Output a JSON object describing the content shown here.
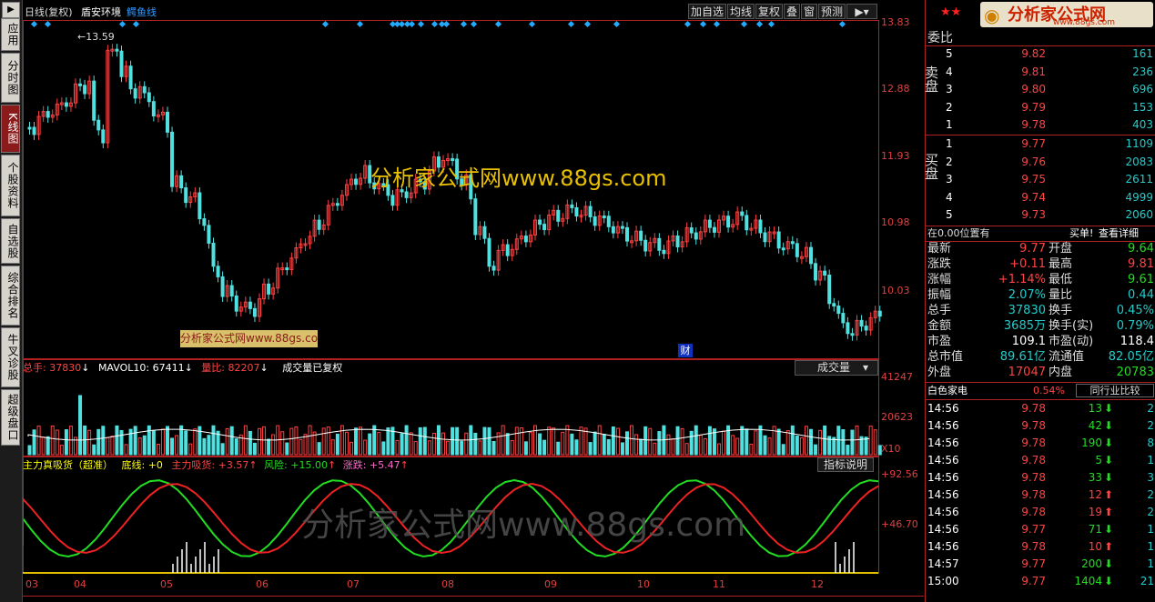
{
  "side_tabs": [
    {
      "label": "应用",
      "active": false
    },
    {
      "label": "分时图",
      "active": false
    },
    {
      "label": "K线图",
      "active": true
    },
    {
      "label": "个股资料",
      "active": false
    },
    {
      "label": "自选股",
      "active": false
    },
    {
      "label": "综合排名",
      "active": false
    },
    {
      "label": "牛叉诊股",
      "active": false
    },
    {
      "label": "超级盘口",
      "active": false
    }
  ],
  "chart_header": {
    "period": "日线(复权)",
    "stock_name": "盾安环境",
    "indicator": "鳄鱼线"
  },
  "toolbar": {
    "add_fav": "加自选",
    "avg": "均线",
    "restore": "复权",
    "overlay": "叠",
    "window": "窗",
    "forecast": "预测"
  },
  "price_axis": [
    "13.83",
    "12.88",
    "11.93",
    "10.98",
    "10.03"
  ],
  "high_marker": "13.59",
  "watermark_main": "分析家公式网www.88gs.com",
  "watermark_small": "分析家公式网www.88gs.com",
  "watermark_bottom": "分析家公式网www.88gs.com",
  "cai_badge": "财",
  "volume_legend": {
    "total_label": "总手:",
    "total_value": "37830",
    "mavol_label": "MAVOL10:",
    "mavol_value": "67411",
    "ratio_label": "量比:",
    "ratio_value": "82207",
    "note": "成交量已复权",
    "selector": "成交量"
  },
  "volume_axis": [
    "41247",
    "20623",
    "X10"
  ],
  "indicator_legend": {
    "name": "主力真吸货（超准）",
    "bottom": "底线: +0",
    "main": "主力吸货: +3.57",
    "risk": "风险: +15.00",
    "rise": "涨跌: +5.47",
    "help": "指标说明"
  },
  "indicator_axis": [
    "+92.56",
    "+46.70"
  ],
  "months": [
    "03",
    "04",
    "05",
    "06",
    "07",
    "08",
    "09",
    "10",
    "11",
    "12"
  ],
  "right_panel": {
    "weibi_label": "委比",
    "sell_label": "卖盘",
    "buy_label": "买盘",
    "asks": [
      {
        "n": "5",
        "p": "9.82",
        "v": "161"
      },
      {
        "n": "4",
        "p": "9.81",
        "v": "236"
      },
      {
        "n": "3",
        "p": "9.80",
        "v": "696"
      },
      {
        "n": "2",
        "p": "9.79",
        "v": "153"
      },
      {
        "n": "1",
        "p": "9.78",
        "v": "403"
      }
    ],
    "bids": [
      {
        "n": "1",
        "p": "9.77",
        "v": "1109"
      },
      {
        "n": "2",
        "p": "9.76",
        "v": "2083"
      },
      {
        "n": "3",
        "p": "9.75",
        "v": "2611"
      },
      {
        "n": "4",
        "p": "9.74",
        "v": "4999"
      },
      {
        "n": "5",
        "p": "9.73",
        "v": "2060"
      }
    ],
    "position_note": "在0.00位置有",
    "buy_detail": "买单!",
    "view_detail": "查看详细",
    "quote_rows": [
      {
        "l1": "最新",
        "v1": "9.77",
        "c1": "red",
        "l2": "开盘",
        "v2": "9.64",
        "c2": "green"
      },
      {
        "l1": "涨跌",
        "v1": "+0.11",
        "c1": "red",
        "l2": "最高",
        "v2": "9.81",
        "c2": "red"
      },
      {
        "l1": "涨幅",
        "v1": "+1.14%",
        "c1": "red",
        "l2": "最低",
        "v2": "9.61",
        "c2": "green"
      },
      {
        "l1": "振幅",
        "v1": "2.07%",
        "c1": "cyan",
        "l2": "量比",
        "v2": "0.44",
        "c2": "cyan"
      },
      {
        "l1": "总手",
        "v1": "37830",
        "c1": "cyan",
        "l2": "换手",
        "v2": "0.45%",
        "c2": "cyan"
      },
      {
        "l1": "金额",
        "v1": "3685万",
        "c1": "cyan",
        "l2": "换手(实)",
        "v2": "0.79%",
        "c2": "cyan"
      },
      {
        "l1": "市盈",
        "v1": "109.1",
        "c1": "white",
        "l2": "市盈(动)",
        "v2": "118.4",
        "c2": "white"
      },
      {
        "l1": "总市值",
        "v1": "89.61亿",
        "c1": "cyan",
        "l2": "流通值",
        "v2": "82.05亿",
        "c2": "cyan"
      },
      {
        "l1": "外盘",
        "v1": "17047",
        "c1": "red",
        "l2": "内盘",
        "v2": "20783",
        "c2": "green"
      }
    ],
    "sector": "白色家电",
    "sector_pct": "0.54%",
    "peer_compare": "同行业比较",
    "ticks": [
      {
        "t": "14:56",
        "p": "9.78",
        "v": "13",
        "d": "down",
        "n": "2"
      },
      {
        "t": "14:56",
        "p": "9.78",
        "v": "42",
        "d": "down",
        "n": "2"
      },
      {
        "t": "14:56",
        "p": "9.78",
        "v": "190",
        "d": "down",
        "n": "8"
      },
      {
        "t": "14:56",
        "p": "9.78",
        "v": "5",
        "d": "down",
        "n": "1"
      },
      {
        "t": "14:56",
        "p": "9.78",
        "v": "33",
        "d": "down",
        "n": "3"
      },
      {
        "t": "14:56",
        "p": "9.78",
        "v": "12",
        "d": "up",
        "n": "2"
      },
      {
        "t": "14:56",
        "p": "9.78",
        "v": "19",
        "d": "up",
        "n": "2"
      },
      {
        "t": "14:56",
        "p": "9.77",
        "v": "71",
        "d": "down",
        "n": "1"
      },
      {
        "t": "14:56",
        "p": "9.78",
        "v": "10",
        "d": "up",
        "n": "1"
      },
      {
        "t": "14:57",
        "p": "9.77",
        "v": "200",
        "d": "down",
        "n": "1"
      },
      {
        "t": "15:00",
        "p": "9.77",
        "v": "1404",
        "d": "down",
        "n": "21"
      }
    ]
  },
  "logo_text": "分析家公式网",
  "logo_url": "www.88gs.com"
}
